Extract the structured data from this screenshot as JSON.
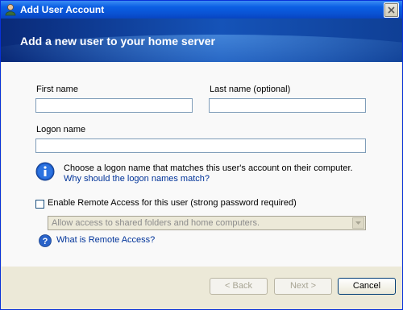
{
  "window": {
    "title": "Add User Account"
  },
  "banner": {
    "heading": "Add a new user to your home server"
  },
  "form": {
    "first_name": {
      "label": "First name",
      "value": ""
    },
    "last_name": {
      "label": "Last name (optional)",
      "value": ""
    },
    "logon_name": {
      "label": "Logon name",
      "value": ""
    },
    "info_text": "Choose a logon name that matches this user's account on their computer.",
    "info_link": "Why should the logon names match?",
    "remote_access": {
      "checkbox_label": "Enable Remote Access for this user (strong password required)",
      "checked": false,
      "select_value": "Allow access to shared folders and home computers.",
      "help_link": "What is Remote Access?"
    }
  },
  "buttons": {
    "back": "< Back",
    "next": "Next >",
    "cancel": "Cancel"
  },
  "icons": {
    "info": "info-icon",
    "help": "help-icon",
    "close": "close-icon",
    "user": "user-icon"
  },
  "colors": {
    "titlebar": "#0a53d4",
    "banner": "#1553b8",
    "link": "#003399"
  }
}
